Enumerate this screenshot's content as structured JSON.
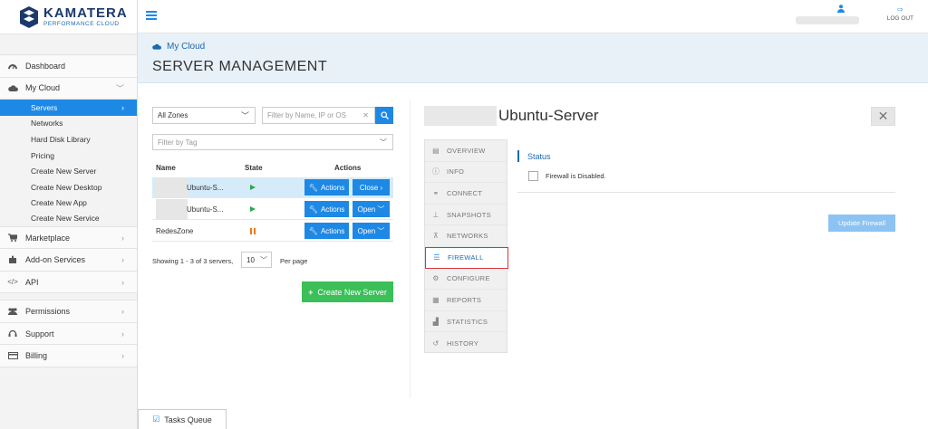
{
  "brand": {
    "name": "KAMATERA",
    "tagline": "PERFORMANCE CLOUD"
  },
  "sidebar": {
    "items": [
      {
        "label": "Dashboard",
        "icon": "dashboard-icon"
      },
      {
        "label": "My Cloud",
        "icon": "cloud-icon",
        "chevron": "﹀"
      }
    ],
    "subitems": [
      {
        "label": "Servers",
        "active": true
      },
      {
        "label": "Networks"
      },
      {
        "label": "Hard Disk Library"
      },
      {
        "label": "Pricing"
      },
      {
        "label": "Create New Server"
      },
      {
        "label": "Create New Desktop"
      },
      {
        "label": "Create New App"
      },
      {
        "label": "Create New Service"
      }
    ],
    "items2": [
      {
        "label": "Marketplace",
        "icon": "cart-icon"
      },
      {
        "label": "Add-on Services",
        "icon": "puzzle-icon"
      },
      {
        "label": "API",
        "icon": "code-icon"
      }
    ],
    "items3": [
      {
        "label": "Permissions",
        "icon": "users-icon"
      },
      {
        "label": "Support",
        "icon": "headset-icon"
      },
      {
        "label": "Billing",
        "icon": "credit-card-icon"
      }
    ]
  },
  "topbar": {
    "logout": "LOG OUT"
  },
  "header": {
    "breadcrumb": "My Cloud",
    "title": "SERVER MANAGEMENT"
  },
  "filters": {
    "zone": "All Zones",
    "search_placeholder": "Filter by Name, IP or OS",
    "tag_placeholder": "Filter by Tag"
  },
  "table": {
    "headers": {
      "name": "Name",
      "state": "State",
      "actions": "Actions"
    },
    "rows": [
      {
        "name": "Ubuntu-S...",
        "state": "running",
        "actions": "Actions",
        "toggle": "Close ›",
        "selected": true
      },
      {
        "name": "Ubuntu-S...",
        "state": "running",
        "actions": "Actions",
        "toggle": "Open ﹀",
        "selected": false
      },
      {
        "name": "RedesZone",
        "state": "paused",
        "actions": "Actions",
        "toggle": "Open ﹀",
        "selected": false
      }
    ]
  },
  "pagination": {
    "showing": "Showing 1 - 3 of 3 servers,",
    "per_page_value": "10",
    "per_page_label": "Per page"
  },
  "create_button": "Create New Server",
  "detail": {
    "server_name": "Ubuntu-Server",
    "tabs": [
      {
        "label": "OVERVIEW",
        "icon": "document-icon"
      },
      {
        "label": "INFO",
        "icon": "info-icon"
      },
      {
        "label": "CONNECT",
        "icon": "link-icon"
      },
      {
        "label": "SNAPSHOTS",
        "icon": "pin-icon"
      },
      {
        "label": "NETWORKS",
        "icon": "network-icon"
      },
      {
        "label": "FIREWALL",
        "icon": "firewall-icon",
        "active": true
      },
      {
        "label": "CONFIGURE",
        "icon": "cogs-icon"
      },
      {
        "label": "REPORTS",
        "icon": "report-icon"
      },
      {
        "label": "STATISTICS",
        "icon": "bar-chart-icon"
      },
      {
        "label": "HISTORY",
        "icon": "history-icon"
      }
    ],
    "status_label": "Status",
    "firewall_status": "Firewall is Disabled.",
    "update_button": "Update Firewall"
  },
  "tasks_queue": "Tasks Queue",
  "colors": {
    "primary": "#1e88e5",
    "success": "#3bbf58",
    "active_border": "#d9343a",
    "header_bg": "#e8f1f8"
  }
}
